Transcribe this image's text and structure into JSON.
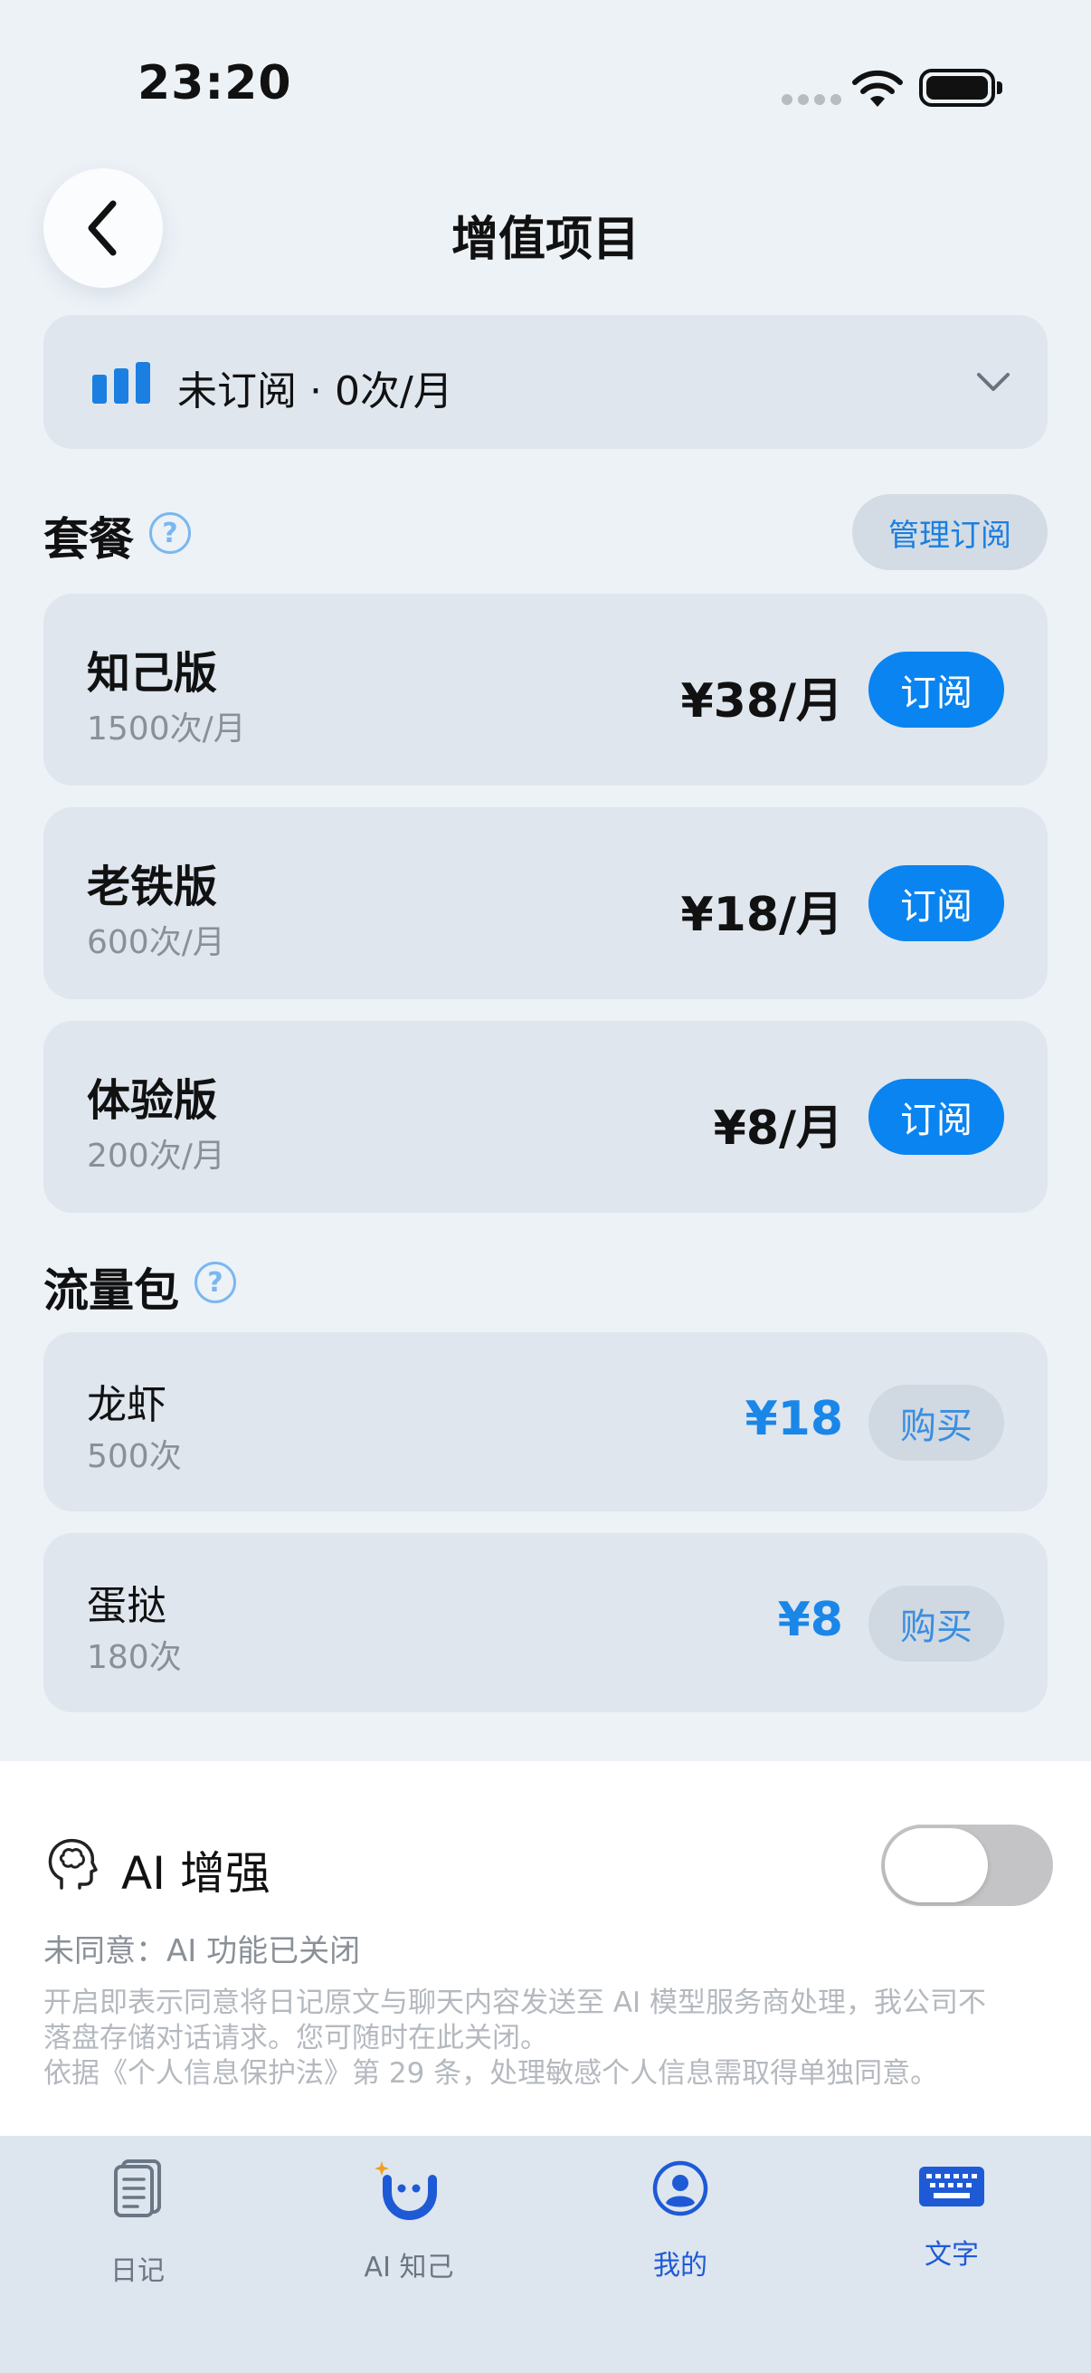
{
  "status_bar": {
    "time": "23:20"
  },
  "header": {
    "title": "增值项目"
  },
  "subscription_bar": {
    "label": "未订阅 · 0次/月"
  },
  "plans_section": {
    "title": "套餐",
    "help": "?",
    "manage_label": "管理订阅"
  },
  "plans": [
    {
      "name": "知己版",
      "quota": "1500次/月",
      "price": "¥38/月",
      "action": "订阅"
    },
    {
      "name": "老铁版",
      "quota": "600次/月",
      "price": "¥18/月",
      "action": "订阅"
    },
    {
      "name": "体验版",
      "quota": "200次/月",
      "price": "¥8/月",
      "action": "订阅"
    }
  ],
  "packs_section": {
    "title": "流量包",
    "help": "?"
  },
  "packs": [
    {
      "name": "龙虾",
      "quota": "500次",
      "price": "¥18",
      "action": "购买"
    },
    {
      "name": "蛋挞",
      "quota": "180次",
      "price": "¥8",
      "action": "购买"
    }
  ],
  "ai": {
    "title": "AI 增强",
    "enabled": false,
    "status": "未同意：AI 功能已关闭",
    "desc_line1": "开启即表示同意将日记原文与聊天内容发送至 AI 模型服务商处理，我公司不",
    "desc_line2": "落盘存储对话请求。您可随时在此关闭。",
    "desc_line3": "依据《个人信息保护法》第 29 条，处理敏感个人信息需取得单独同意。"
  },
  "tabbar": {
    "items": [
      {
        "label": "日记",
        "icon": "diary-icon"
      },
      {
        "label": "AI 知己",
        "icon": "ai-companion-icon"
      },
      {
        "label": "我的",
        "icon": "profile-icon"
      },
      {
        "label": "文字",
        "icon": "keyboard-icon"
      }
    ]
  },
  "colors": {
    "accent": "#0a84f0",
    "background": "#edf2f7",
    "card": "#dfe6ee"
  }
}
